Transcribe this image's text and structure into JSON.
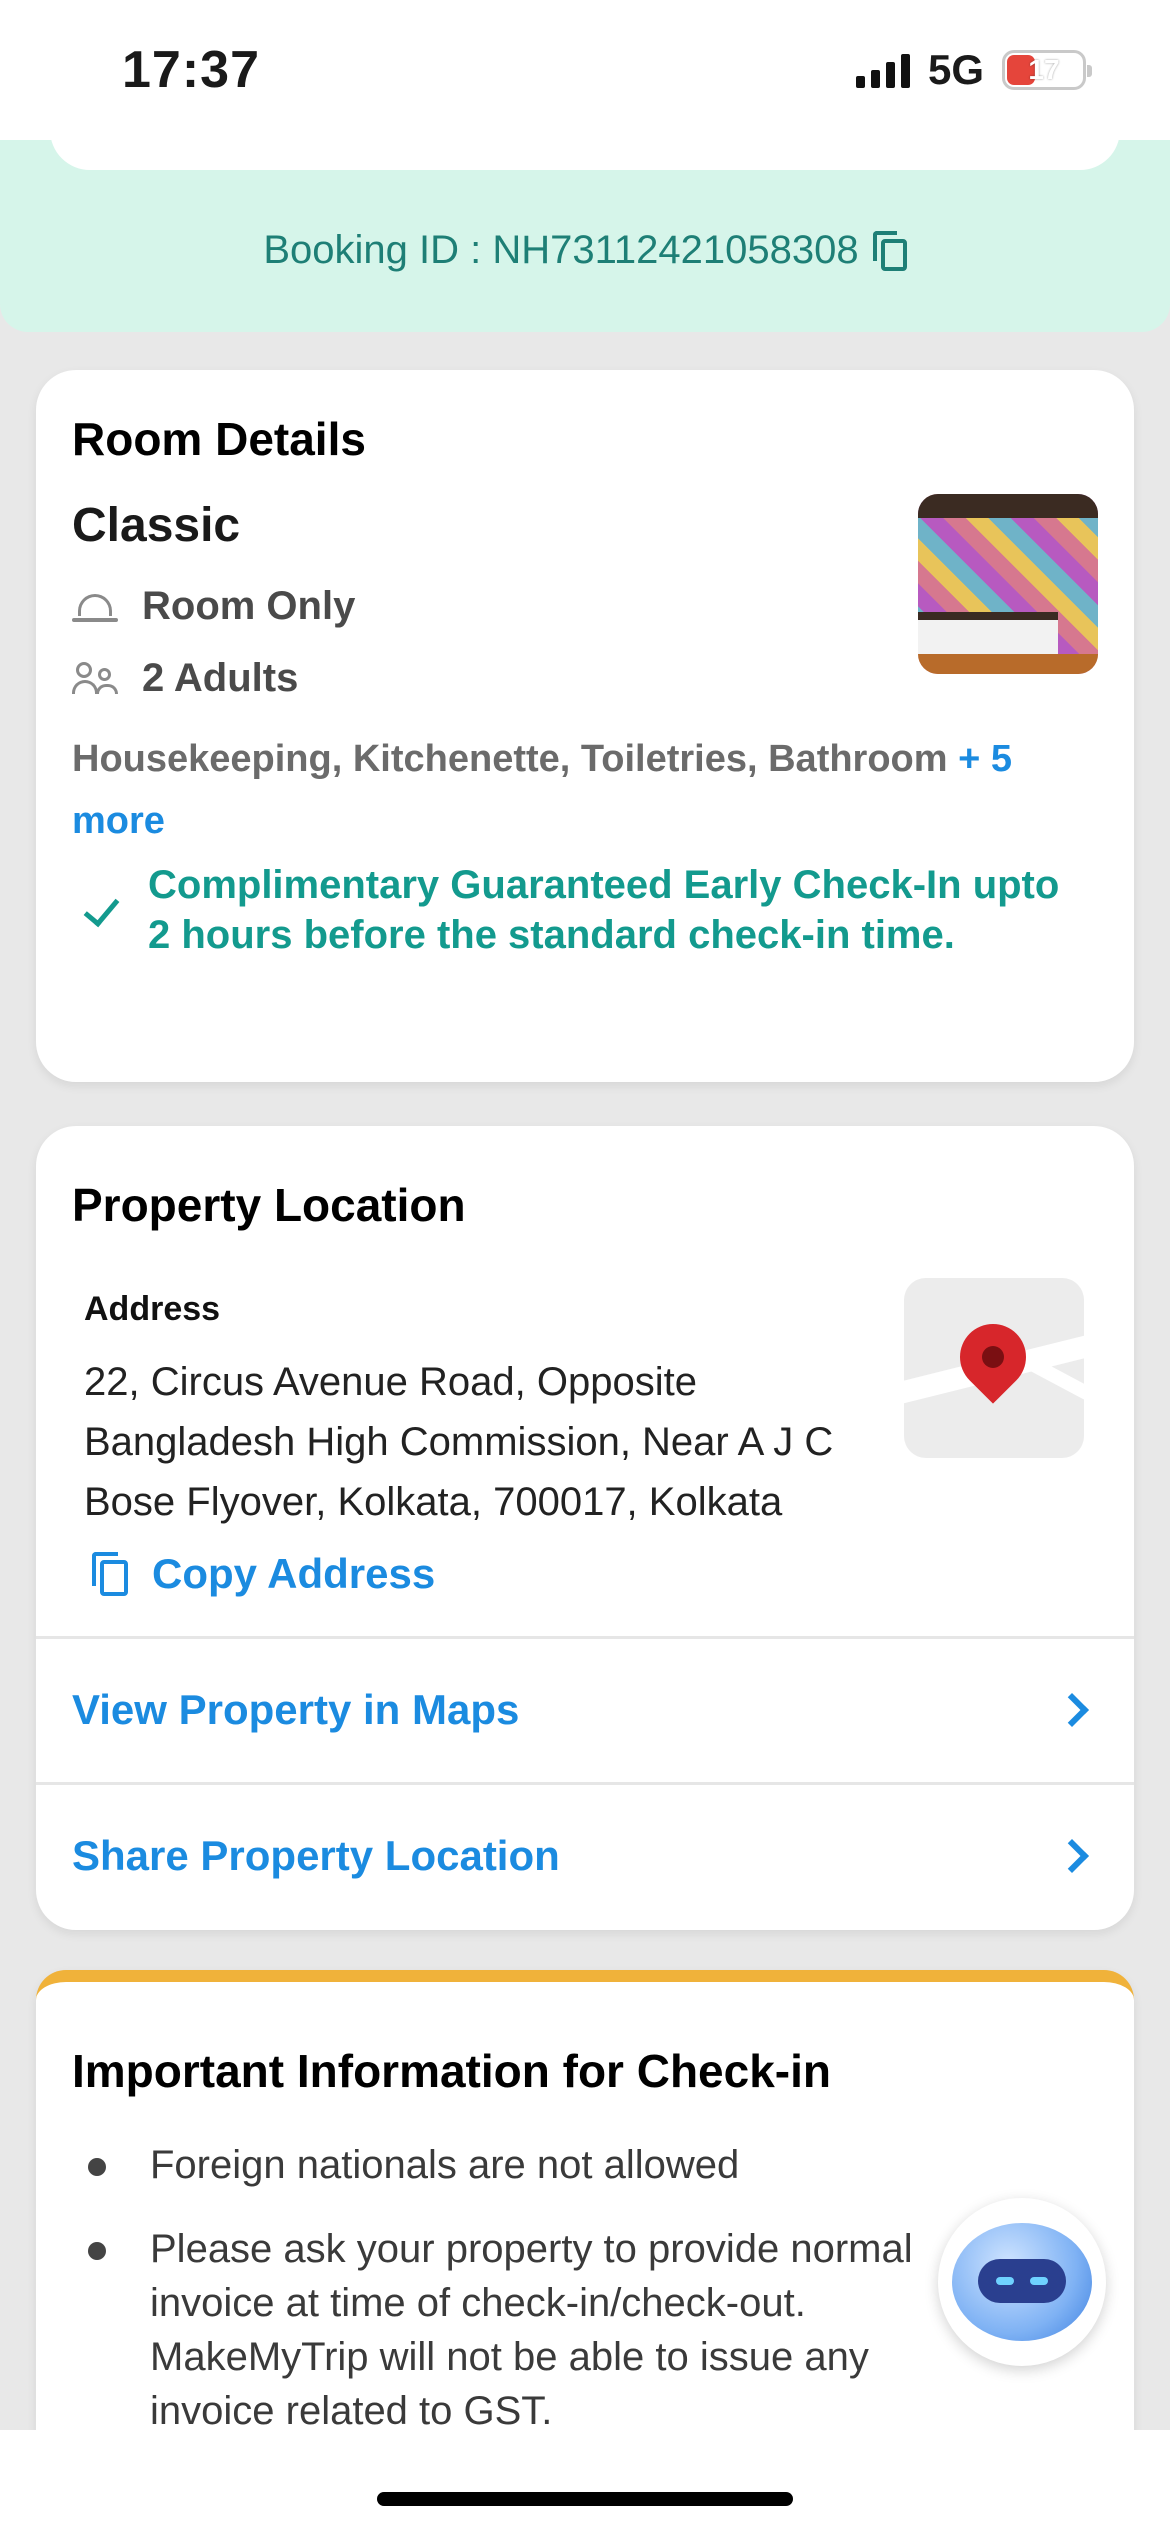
{
  "status_bar": {
    "time": "17:37",
    "network": "5G",
    "battery": "17",
    "battery_color": "#e5453b"
  },
  "booking": {
    "id_text": "Booking ID : NH73112421058308",
    "copy_icon": "copy-icon",
    "color": "#1e7f76"
  },
  "room_details": {
    "title": "Room Details",
    "room_name": "Classic",
    "meal_plan": "Room Only",
    "meal_icon": "cloche-icon",
    "guests": "2 Adults",
    "guests_icon": "people-icon",
    "amenities": "Housekeeping, Kitchenette, Toiletries, Bathroom",
    "more_link": "+ 5 more",
    "early_checkin": "Complimentary Guaranteed Early Check-In upto 2 hours before the standard check-in time.",
    "accent": "#139a8e"
  },
  "property_location": {
    "title": "Property Location",
    "address_label": "Address",
    "address": "22, Circus Avenue Road, Opposite Bangladesh High Commission, Near A J C Bose Flyover, Kolkata, 700017, Kolkata",
    "copy_address": "Copy Address",
    "view_in_maps": "View Property in Maps",
    "share_location": "Share Property Location",
    "link_color": "#1b8be0"
  },
  "important_info": {
    "title": "Important Information for Check-in",
    "items": [
      "Foreign nationals are not allowed",
      "Please ask your property to provide normal invoice at time of check-in/check-out. MakeMyTrip will not be able to issue any invoice related to GST."
    ]
  }
}
